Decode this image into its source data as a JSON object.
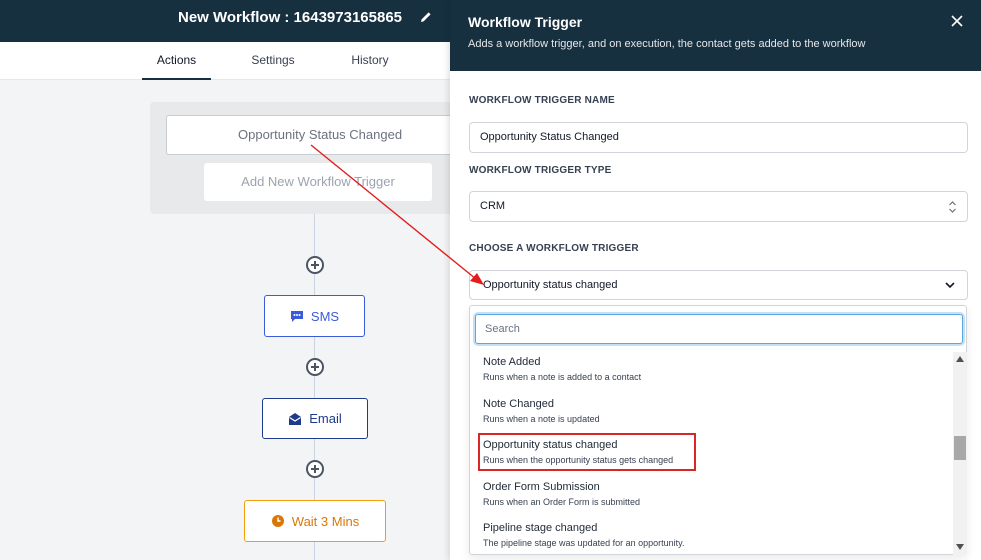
{
  "workflow": {
    "title": "New Workflow : 1643973165865",
    "tabs": [
      {
        "label": "Actions",
        "active": true
      },
      {
        "label": "Settings",
        "active": false
      },
      {
        "label": "History",
        "active": false
      }
    ]
  },
  "canvas": {
    "trigger_label": "Opportunity Status Changed",
    "add_trigger_label": "Add New Workflow Trigger",
    "actions": [
      {
        "label": "SMS",
        "icon": "sms-icon"
      },
      {
        "label": "Email",
        "icon": "email-icon"
      },
      {
        "label": "Wait 3 Mins",
        "icon": "clock-icon"
      }
    ]
  },
  "panel": {
    "title": "Workflow Trigger",
    "subtitle": "Adds a workflow trigger, and on execution, the contact gets added to the workflow",
    "name_label": "WORKFLOW TRIGGER NAME",
    "name_value": "Opportunity Status Changed",
    "type_label": "WORKFLOW TRIGGER TYPE",
    "type_value": "CRM",
    "choose_label": "CHOOSE A WORKFLOW TRIGGER",
    "choose_value": "Opportunity status changed",
    "search_placeholder": "Search",
    "options": [
      {
        "name": "Note Added",
        "desc": "Runs when a note is added to a contact"
      },
      {
        "name": "Note Changed",
        "desc": "Runs when a note is updated"
      },
      {
        "name": "Opportunity status changed",
        "desc": "Runs when the opportunity status gets changed",
        "highlighted": true
      },
      {
        "name": "Order Form Submission",
        "desc": "Runs when an Order Form is submitted"
      },
      {
        "name": "Pipeline stage changed",
        "desc": "The pipeline stage was updated for an opportunity."
      }
    ]
  },
  "colors": {
    "header_bg": "#17303f",
    "annotation_red": "#dc2626",
    "sms_blue": "#3b5bdb",
    "wait_orange": "#d97706"
  }
}
